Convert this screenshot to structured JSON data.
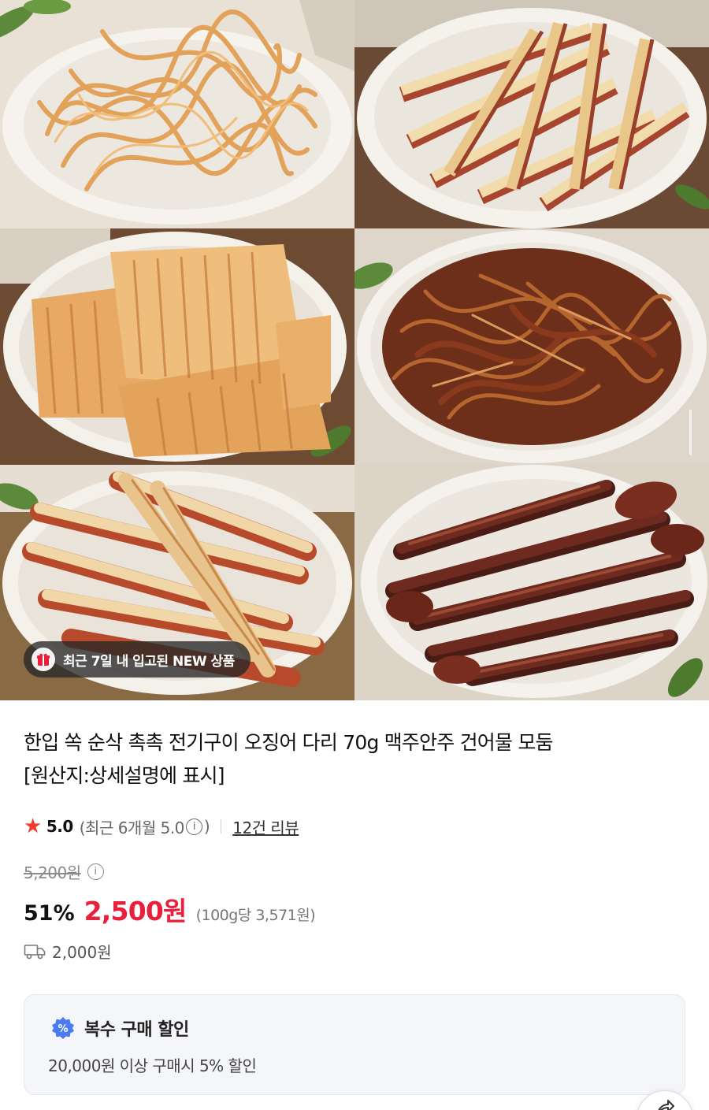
{
  "badge": {
    "label": "최근 7일 내 입고된 NEW 상품",
    "icon": "gift-icon"
  },
  "product": {
    "title_line1": "한입 쏙 순삭 촉촉 전기구이 오징어 다리 70g 맥주안주 건어물 모둠",
    "title_line2": "[원산지:상세설명에 표시]"
  },
  "rating": {
    "score": "5.0",
    "recent_text": "(최근 6개월 5.0",
    "recent_close": ")",
    "reviews": "12건 리뷰"
  },
  "price": {
    "original": "5,200원",
    "discount": "51%",
    "sale": "2,500원",
    "unit": "(100g당 3,571원)"
  },
  "shipping": {
    "fee": "2,000원"
  },
  "multi_buy": {
    "title": "복수 구매 할인",
    "desc": "20,000원 이상 구매시 5% 할인"
  },
  "colors": {
    "accent_red": "#e8203c",
    "star": "#f23a2f",
    "badge_blue": "#4a7bf0"
  },
  "photos": [
    "shredded-squid",
    "squid-sticks",
    "grilled-squid-sheets",
    "seasoned-squid-strips",
    "squid-legs-sticks",
    "dried-squid-legs"
  ]
}
